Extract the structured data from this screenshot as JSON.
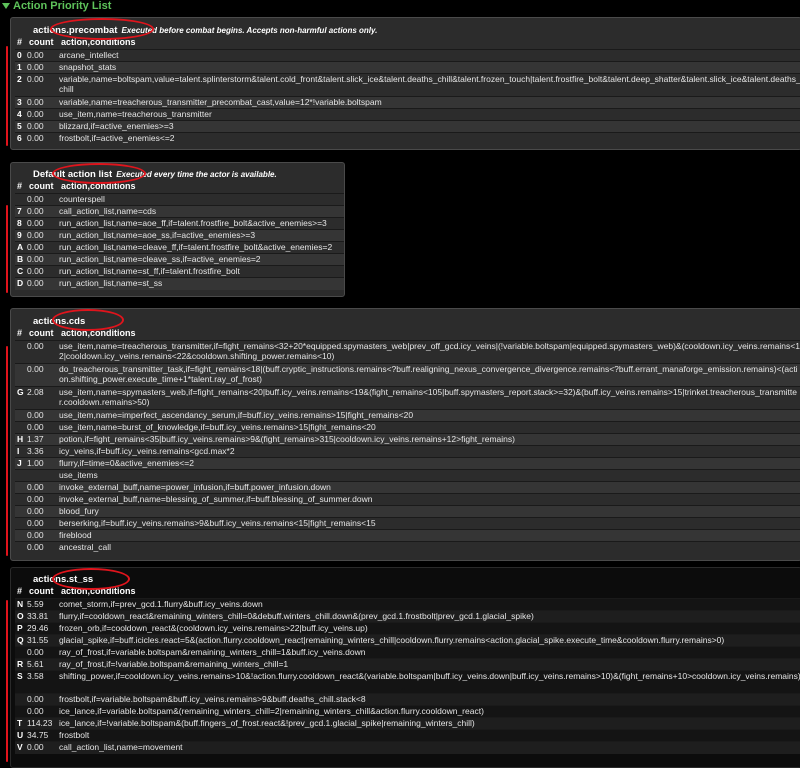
{
  "header": {
    "title": "Action Priority List"
  },
  "columns": {
    "idx": "#",
    "count": "count",
    "action": "action,conditions"
  },
  "sections": {
    "precombat": {
      "title": "actions.precombat",
      "desc": "Executed before combat begins. Accepts non-harmful actions only.",
      "rows": [
        {
          "idx": "0",
          "count": "0.00",
          "action": "arcane_intellect"
        },
        {
          "idx": "1",
          "count": "0.00",
          "action": "snapshot_stats"
        },
        {
          "idx": "2",
          "count": "0.00",
          "action": "variable,name=boltspam,value=talent.splinterstorm&talent.cold_front&talent.slick_ice&talent.deaths_chill&talent.frozen_touch|talent.frostfire_bolt&talent.deep_shatter&talent.slick_ice&talent.deaths_chill"
        },
        {
          "idx": "3",
          "count": "0.00",
          "action": "variable,name=treacherous_transmitter_precombat_cast,value=12*!variable.boltspam"
        },
        {
          "idx": "4",
          "count": "0.00",
          "action": "use_item,name=treacherous_transmitter"
        },
        {
          "idx": "5",
          "count": "0.00",
          "action": "blizzard,if=active_enemies>=3"
        },
        {
          "idx": "6",
          "count": "0.00",
          "action": "frostbolt,if=active_enemies<=2"
        }
      ]
    },
    "default": {
      "title": "Default action list",
      "desc": "Executed every time the actor is available.",
      "rows": [
        {
          "idx": "",
          "count": "0.00",
          "action": "counterspell"
        },
        {
          "idx": "7",
          "count": "0.00",
          "action": "call_action_list,name=cds"
        },
        {
          "idx": "8",
          "count": "0.00",
          "action": "run_action_list,name=aoe_ff,if=talent.frostfire_bolt&active_enemies>=3"
        },
        {
          "idx": "9",
          "count": "0.00",
          "action": "run_action_list,name=aoe_ss,if=active_enemies>=3"
        },
        {
          "idx": "A",
          "count": "0.00",
          "action": "run_action_list,name=cleave_ff,if=talent.frostfire_bolt&active_enemies=2"
        },
        {
          "idx": "B",
          "count": "0.00",
          "action": "run_action_list,name=cleave_ss,if=active_enemies=2"
        },
        {
          "idx": "C",
          "count": "0.00",
          "action": "run_action_list,name=st_ff,if=talent.frostfire_bolt"
        },
        {
          "idx": "D",
          "count": "0.00",
          "action": "run_action_list,name=st_ss"
        }
      ]
    },
    "cds": {
      "title": "actions.cds",
      "desc": "",
      "rows": [
        {
          "idx": "",
          "count": "0.00",
          "action": "use_item,name=treacherous_transmitter,if=fight_remains<32+20*equipped.spymasters_web|prev_off_gcd.icy_veins|(!variable.boltspam|equipped.spymasters_web)&(cooldown.icy_veins.remains<12|cooldown.icy_veins.remains<22&cooldown.shifting_power.remains<10)"
        },
        {
          "idx": "",
          "count": "0.00",
          "action": "do_treacherous_transmitter_task,if=fight_remains<18|(buff.cryptic_instructions.remains<?buff.realigning_nexus_convergence_divergence.remains<?buff.errant_manaforge_emission.remains)<(action.shifting_power.execute_time+1*talent.ray_of_frost)"
        },
        {
          "idx": "G",
          "count": "2.08",
          "action": "use_item,name=spymasters_web,if=fight_remains<20|buff.icy_veins.remains<19&(fight_remains<105|buff.spymasters_report.stack>=32)&(buff.icy_veins.remains>15|trinket.treacherous_transmitter.cooldown.remains>50)"
        },
        {
          "idx": "",
          "count": "0.00",
          "action": "use_item,name=imperfect_ascendancy_serum,if=buff.icy_veins.remains>15|fight_remains<20"
        },
        {
          "idx": "",
          "count": "0.00",
          "action": "use_item,name=burst_of_knowledge,if=buff.icy_veins.remains>15|fight_remains<20"
        },
        {
          "idx": "H",
          "count": "1.37",
          "action": "potion,if=fight_remains<35|buff.icy_veins.remains>9&(fight_remains>315|cooldown.icy_veins.remains+12>fight_remains)"
        },
        {
          "idx": "I",
          "count": "3.36",
          "action": "icy_veins,if=buff.icy_veins.remains<gcd.max*2"
        },
        {
          "idx": "J",
          "count": "1.00",
          "action": "flurry,if=time=0&active_enemies<=2"
        },
        {
          "idx": "",
          "count": "",
          "action": "use_items"
        },
        {
          "idx": "",
          "count": "0.00",
          "action": "invoke_external_buff,name=power_infusion,if=buff.power_infusion.down"
        },
        {
          "idx": "",
          "count": "0.00",
          "action": "invoke_external_buff,name=blessing_of_summer,if=buff.blessing_of_summer.down"
        },
        {
          "idx": "",
          "count": "0.00",
          "action": "blood_fury"
        },
        {
          "idx": "",
          "count": "0.00",
          "action": "berserking,if=buff.icy_veins.remains>9&buff.icy_veins.remains<15|fight_remains<15"
        },
        {
          "idx": "",
          "count": "0.00",
          "action": "fireblood"
        },
        {
          "idx": "",
          "count": "0.00",
          "action": "ancestral_call"
        }
      ]
    },
    "st_ss": {
      "title": "actions.st_ss",
      "desc": "",
      "rows": [
        {
          "idx": "N",
          "count": "5.59",
          "action": "comet_storm,if=prev_gcd.1.flurry&buff.icy_veins.down"
        },
        {
          "idx": "O",
          "count": "33.81",
          "action": "flurry,if=cooldown_react&remaining_winters_chill=0&debuff.winters_chill.down&(prev_gcd.1.frostbolt|prev_gcd.1.glacial_spike)"
        },
        {
          "idx": "P",
          "count": "29.46",
          "action": "frozen_orb,if=cooldown_react&(cooldown.icy_veins.remains>22|buff.icy_veins.up)"
        },
        {
          "idx": "Q",
          "count": "31.55",
          "action": "glacial_spike,if=buff.icicles.react=5&(action.flurry.cooldown_react|remaining_winters_chill|cooldown.flurry.remains<action.glacial_spike.execute_time&cooldown.flurry.remains>0)"
        },
        {
          "idx": "",
          "count": "0.00",
          "action": "ray_of_frost,if=variable.boltspam&remaining_winters_chill=1&buff.icy_veins.down"
        },
        {
          "idx": "R",
          "count": "5.61",
          "action": "ray_of_frost,if=!variable.boltspam&remaining_winters_chill=1"
        },
        {
          "idx": "S",
          "count": "3.58",
          "action": "shifting_power,if=cooldown.icy_veins.remains>10&!action.flurry.cooldown_react&(variable.boltspam|buff.icy_veins.down|buff.icy_veins.remains>10)&(fight_remains+10>cooldown.icy_veins.remains)"
        },
        {
          "idx": "",
          "count": "0.00",
          "action": "frostbolt,if=variable.boltspam&buff.icy_veins.remains>9&buff.deaths_chill.stack<8"
        },
        {
          "idx": "",
          "count": "0.00",
          "action": "ice_lance,if=variable.boltspam&(remaining_winters_chill=2|remaining_winters_chill&action.flurry.cooldown_react)"
        },
        {
          "idx": "T",
          "count": "114.23",
          "action": "ice_lance,if=!variable.boltspam&(buff.fingers_of_frost.react&!prev_gcd.1.glacial_spike|remaining_winters_chill)"
        },
        {
          "idx": "U",
          "count": "34.75",
          "action": "frostbolt"
        },
        {
          "idx": "V",
          "count": "0.00",
          "action": "call_action_list,name=movement"
        }
      ]
    }
  }
}
